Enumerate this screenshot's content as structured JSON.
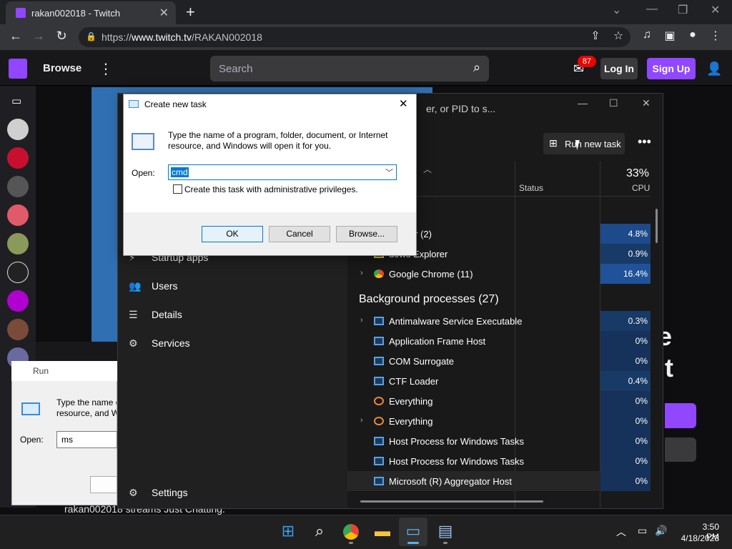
{
  "browser": {
    "tab_title": "rakan002018 - Twitch",
    "tab_close": "✕",
    "new_tab": "+",
    "url_prefix": "https://",
    "url_host": "www.twitch.tv",
    "url_path": "/RAKAN002018"
  },
  "twitch": {
    "browse_label": "Browse",
    "search_placeholder": "Search",
    "inbox_count": "87",
    "login_label": "Log In",
    "signup_label": "Sign Up",
    "offline_letter_1": "e",
    "offline_letter_2": "t",
    "stream_caption": "rakan002018 streams Just Chatting."
  },
  "task_manager": {
    "search_placeholder": "er, or PID to s...",
    "run_new_task_label": "Run new task",
    "columns": {
      "status": "Status",
      "cpu_label": "CPU",
      "cpu_total": "33%"
    },
    "nav": [
      {
        "label": "Startup apps",
        "icon": "startup-icon"
      },
      {
        "label": "Users",
        "icon": "users-icon"
      },
      {
        "label": "Details",
        "icon": "details-icon"
      },
      {
        "label": "Services",
        "icon": "services-icon"
      },
      {
        "label": "Settings",
        "icon": "settings-icon"
      }
    ],
    "apps": [
      {
        "name": "anager (2)",
        "cpu": "4.8%"
      },
      {
        "name": "dows Explorer",
        "cpu": "0.9%"
      },
      {
        "name": "Google Chrome (11)",
        "cpu": "16.4%"
      }
    ],
    "background_heading": "Background processes (27)",
    "background": [
      {
        "name": "Antimalware Service Executable",
        "cpu": "0.3%"
      },
      {
        "name": "Application Frame Host",
        "cpu": "0%"
      },
      {
        "name": "COM Surrogate",
        "cpu": "0%"
      },
      {
        "name": "CTF Loader",
        "cpu": "0.4%"
      },
      {
        "name": "Everything",
        "cpu": "0%"
      },
      {
        "name": "Everything",
        "cpu": "0%"
      },
      {
        "name": "Host Process for Windows Tasks",
        "cpu": "0%"
      },
      {
        "name": "Host Process for Windows Tasks",
        "cpu": "0%"
      },
      {
        "name": "Microsoft (R) Aggregator Host",
        "cpu": "0%"
      }
    ]
  },
  "create_task_dialog": {
    "title": "Create new task",
    "close": "✕",
    "description": "Type the name of a program, folder, document, or Internet resource, and Windows will open it for you.",
    "open_label": "Open:",
    "open_value": "cmd",
    "admin_label": "Create this task with administrative privileges.",
    "ok": "OK",
    "cancel": "Cancel",
    "browse": "Browse..."
  },
  "run_dialog": {
    "title": "Run",
    "description_1": "Type the name o",
    "description_2": "resource, and W",
    "open_label": "Open:",
    "open_value": "ms"
  },
  "taskbar": {
    "time": "3:50 PM",
    "date": "4/18/2023"
  }
}
